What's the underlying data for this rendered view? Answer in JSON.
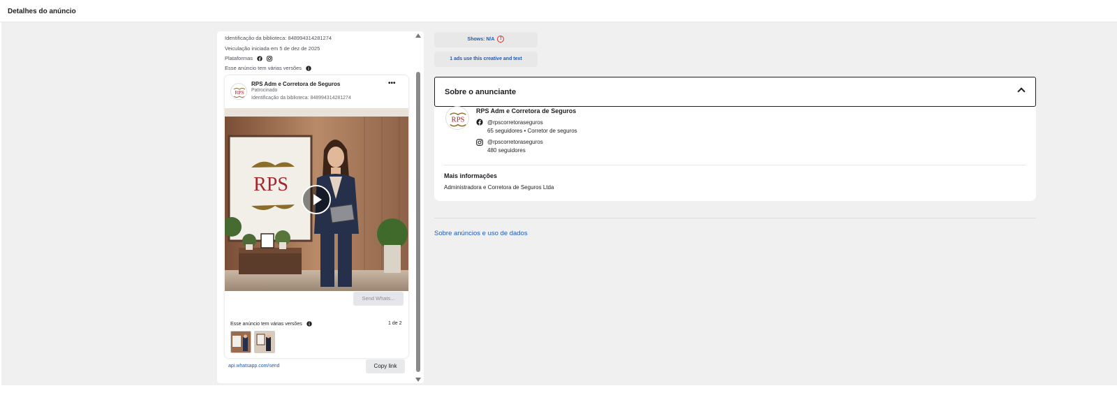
{
  "header": {
    "title": "Detalhes do anúncio"
  },
  "ad_meta": {
    "library_id": "Identificação da biblioteca: 848994314281274",
    "started": "Veiculação iniciada em 5 de dez de 2025",
    "platforms_label": "Plataformas",
    "platform_icons": [
      "facebook-icon",
      "instagram-icon"
    ],
    "versions_note": "Esse anúncio tem várias versões"
  },
  "ad_card": {
    "advertiser": "RPS Adm e Corretora de Seguros",
    "sponsored": "Patrocinado",
    "library_id": "Identificação da biblioteca: 848994314281274",
    "logo_text": "RPS",
    "cta_label": "Send Whats...",
    "versions_label": "Esse anúncio tem várias versões",
    "versions_count": "1 de 2",
    "link_url": "api.whatsapp.com/send",
    "copy_link": "Copy link"
  },
  "right": {
    "shows": "Shows: N/A",
    "creative_note": "1 ads use this creative and text",
    "about_title": "Sobre o anunciante",
    "advertiser_name": "RPS Adm e Corretora de Seguros",
    "facebook": {
      "handle": "@rpscorretoraseguros",
      "stats": "65 seguidores • Corretor de seguros"
    },
    "instagram": {
      "handle": "@rpscorretoraseguros",
      "stats": "480 seguidores"
    },
    "more_info_title": "Mais informações",
    "more_info_text": "Administradora e Corretora de Seguros Ltda",
    "about_ads_link": "Sobre anúncios e uso de dados"
  },
  "colors": {
    "link": "#1e5bb8",
    "background": "#f0f0f0",
    "warning": "#d93025",
    "brand": "#a3272c"
  }
}
